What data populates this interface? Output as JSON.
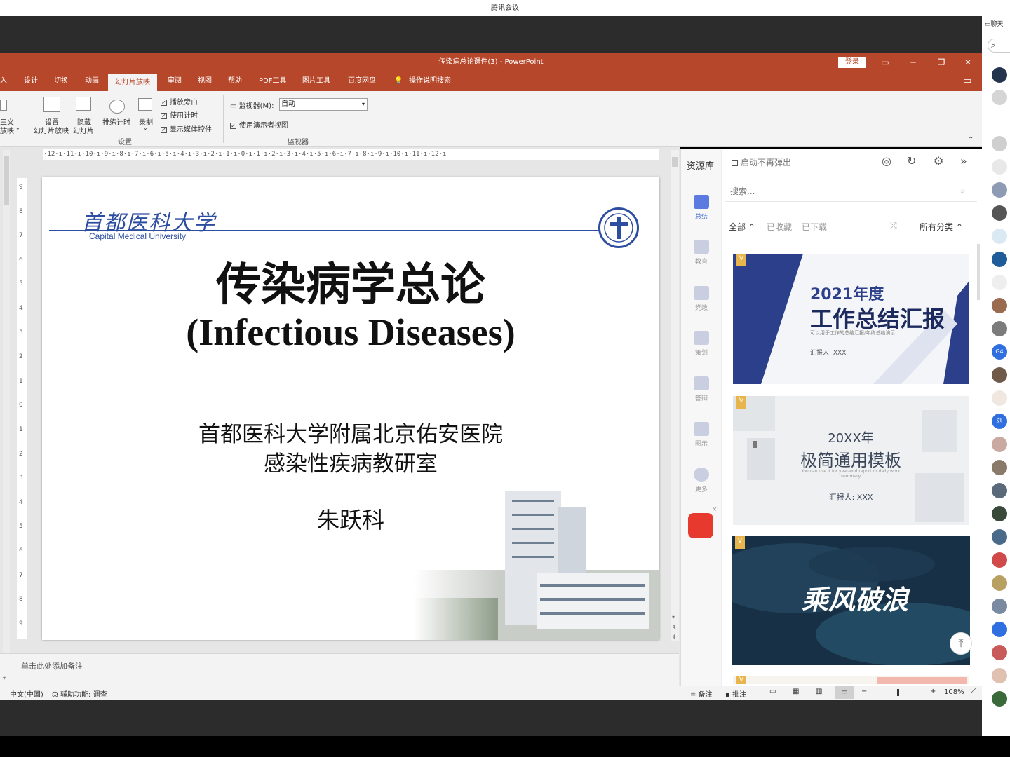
{
  "outer_window": {
    "title": "腾讯会议"
  },
  "ppt": {
    "title": "传染病总论课件(3)  -  PowerPoint",
    "login": "登录",
    "tabs": [
      "入",
      "设计",
      "切换",
      "动画",
      "幻灯片放映",
      "审阅",
      "视图",
      "帮助",
      "PDF工具",
      "图片工具",
      "百度网盘",
      "操作说明搜索"
    ],
    "active_tab": "幻灯片放映"
  },
  "ribbon": {
    "custom_show": {
      "line1": "三义",
      "line2": "放映"
    },
    "setup_show": {
      "line1": "设置",
      "line2": "幻灯片放映"
    },
    "hide_slide": {
      "line1": "隐藏",
      "line2": "幻灯片"
    },
    "rehearse": "排练计时",
    "record": "录制",
    "checkboxes": [
      {
        "label": "播放旁白",
        "checked": true
      },
      {
        "label": "使用计时",
        "checked": true
      },
      {
        "label": "显示媒体控件",
        "checked": true
      }
    ],
    "group_setup": "设置",
    "monitor_label": "监视器(M):",
    "monitor_value": "自动",
    "presenter_view": {
      "label": "使用演示者视图",
      "checked": true
    },
    "group_monitors": "监视器"
  },
  "ruler_h": "·12·ı·11·ı·10·ı·9·ı·8·ı·7·ı·6·ı·5·ı·4·ı·3·ı·2·ı·1·ı·0·ı·1·ı·2·ı·3·ı·4·ı·5·ı·6·ı·7·ı·8·ı·9·ı·10·ı·11·ı·12·ı",
  "slide": {
    "logo_cn": "首都医科大学",
    "logo_en": "Capital Medical University",
    "title_cn": "传染病学总论",
    "title_en": "(Infectious Diseases)",
    "institution": "首都医科大学附属北京佑安医院",
    "department": "感染性疾病教研室",
    "author": "朱跃科"
  },
  "notes_placeholder": "单击此处添加备注",
  "statusbar": {
    "language": "中文(中国)",
    "accessibility": "辅助功能: 调查",
    "notes": "备注",
    "comments": "批注",
    "zoom": "108%"
  },
  "panel": {
    "title": "资源库",
    "no_popup": "启动不再弹出",
    "search_placeholder": "搜索...",
    "filters": [
      "全部",
      "已收藏",
      "已下载"
    ],
    "category": "所有分类",
    "nav": [
      "总结",
      "教育",
      "党政",
      "策划",
      "答辩",
      "图示",
      "更多"
    ],
    "templates": [
      {
        "badge": "V",
        "year": "2021年度",
        "title": "工作总结汇报",
        "subtitle": "可以用于工作的总结汇报/年终总结演示",
        "reporter": "汇报人: XXX"
      },
      {
        "badge": "V",
        "year": "20XX年",
        "title": "极简通用模板",
        "subtitle": "You can use it for year-end report or daily work summary",
        "reporter": "汇报人: XXX"
      },
      {
        "badge": "V",
        "title": "乘风破浪"
      }
    ]
  },
  "meeting_sidebar": {
    "chat": "聊天",
    "avatar_labels": [
      "G4",
      "刘"
    ]
  },
  "colors": {
    "ppt_accent": "#b7472a",
    "template1_blue": "#2b3f8a",
    "template3_navy": "#173045"
  }
}
